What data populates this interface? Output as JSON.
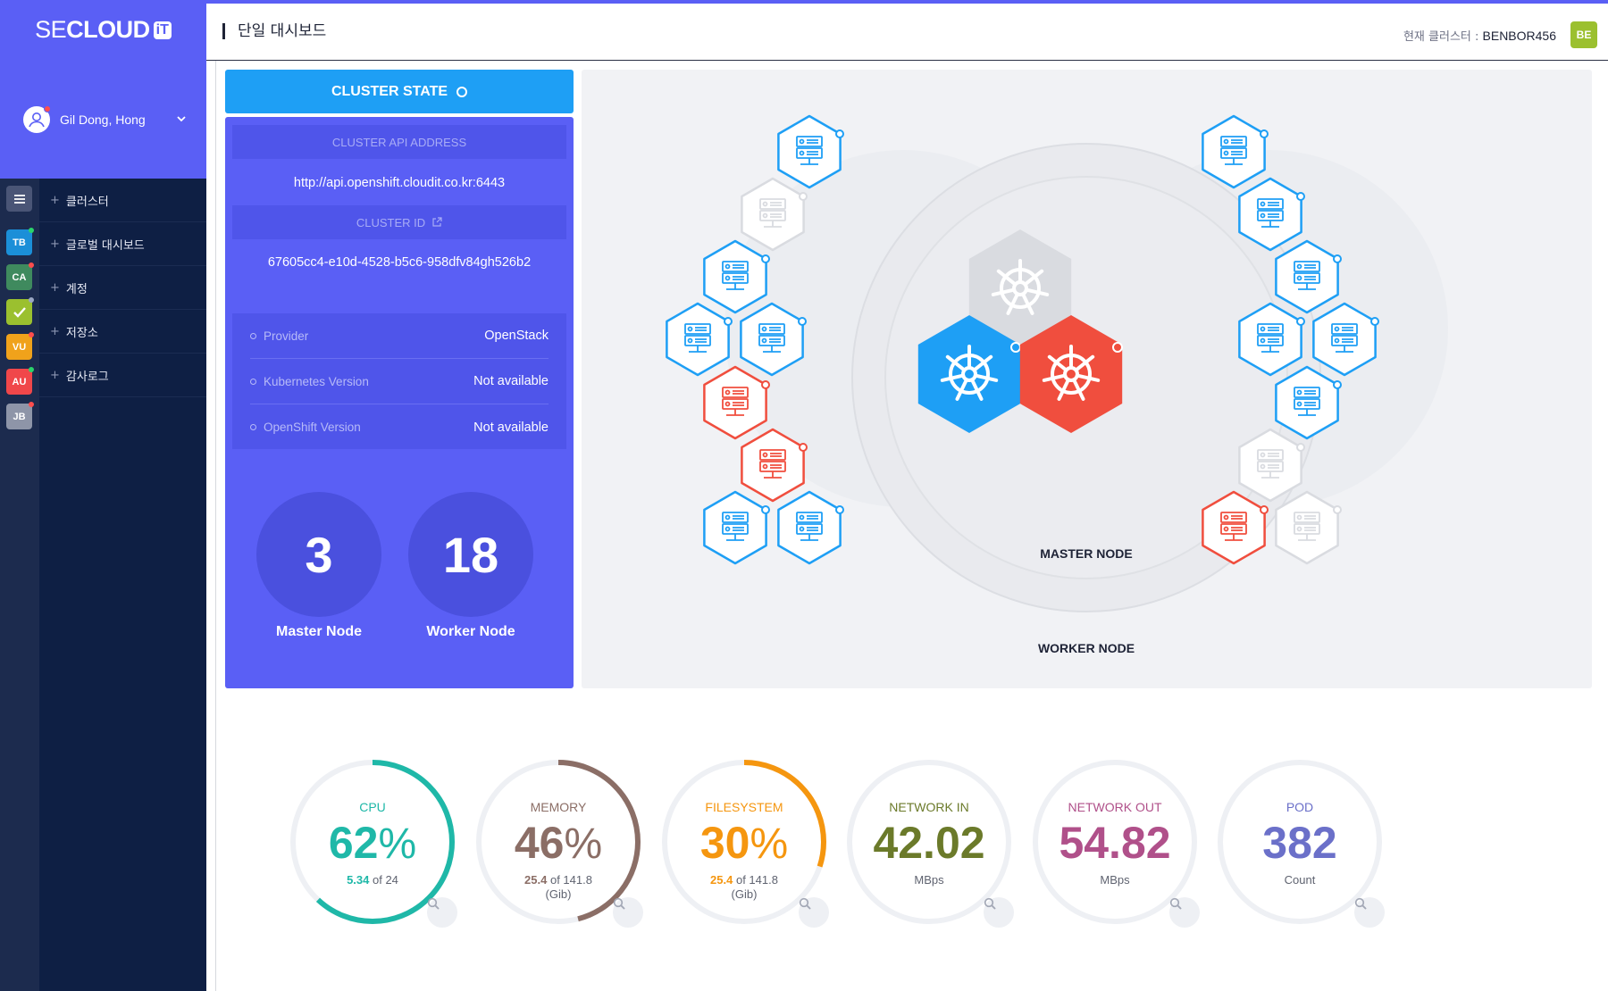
{
  "brand": {
    "name_light": "SE",
    "name_bold": "CLOUD",
    "badge": "iT"
  },
  "user": {
    "name": "Gil Dong, Hong"
  },
  "rail": [
    {
      "code": "",
      "icon": "menu-icon",
      "color": "#4a5576",
      "dot": ""
    },
    {
      "code": "TB",
      "color": "#1b8fd8",
      "dot": "#2bd46b"
    },
    {
      "code": "CA",
      "color": "#3f8a5e",
      "dot": "#ff4d4d"
    },
    {
      "code": "",
      "icon": "check-icon",
      "color": "#9bc02f",
      "dot": "#9ba7c4"
    },
    {
      "code": "VU",
      "color": "#f0a21b",
      "dot": "#ff4d4d"
    },
    {
      "code": "AU",
      "color": "#f0474a",
      "dot": "#2bd46b"
    },
    {
      "code": "JB",
      "color": "#8e95a8",
      "dot": "#ff4d4d"
    }
  ],
  "nav": [
    "클러스터",
    "글로벌 대시보드",
    "계정",
    "저장소",
    "감사로그"
  ],
  "header": {
    "title": "단일 대시보드",
    "cluster_label": "현재 클러스터 : ",
    "cluster_name": "BENBOR456",
    "cluster_badge": "BE"
  },
  "cluster_state": {
    "title": "CLUSTER STATE",
    "api_label": "CLUSTER API ADDRESS",
    "api_value": "http://api.openshift.cloudit.co.kr:6443",
    "id_label": "CLUSTER ID",
    "id_value": "67605cc4-e10d-4528-b5c6-958dfv84gh526b2",
    "properties": [
      {
        "label": "Provider",
        "value": "OpenStack"
      },
      {
        "label": "Kubernetes Version",
        "value": "Not available"
      },
      {
        "label": "OpenShift Version",
        "value": "Not available"
      }
    ],
    "master_count": "3",
    "master_label": "Master Node",
    "worker_count": "18",
    "worker_label": "Worker Node"
  },
  "topology": {
    "master_label": "MASTER NODE",
    "worker_label": "WORKER NODE",
    "colors": {
      "active": "#1e9ff5",
      "error": "#f04e3e",
      "idle": "#d9dbe0"
    },
    "master_nodes": [
      "idle",
      "active",
      "error"
    ],
    "worker_nodes_left": [
      "active",
      "idle",
      "active",
      "active",
      "active",
      "error",
      "error",
      "active",
      "active"
    ],
    "worker_nodes_right": [
      "active",
      "active",
      "active",
      "active",
      "active",
      "active",
      "idle",
      "error",
      "idle"
    ]
  },
  "metrics": [
    {
      "label": "CPU",
      "value": "62",
      "unit": "%",
      "fraction": 0.62,
      "used": "5.34",
      "of": "of 24",
      "sub2": "",
      "color": "#1fb8a8"
    },
    {
      "label": "MEMORY",
      "value": "46",
      "unit": "%",
      "fraction": 0.46,
      "used": "25.4",
      "of": "of 141.8",
      "sub2": "(Gib)",
      "color": "#8b6e66"
    },
    {
      "label": "FILESYSTEM",
      "value": "30",
      "unit": "%",
      "fraction": 0.3,
      "used": "25.4",
      "of": "of 141.8",
      "sub2": "(Gib)",
      "color": "#f5960f"
    },
    {
      "label": "NETWORK IN",
      "value": "42.02",
      "unit": "",
      "fraction": 0,
      "used": "",
      "of": "MBps",
      "sub2": "",
      "color": "#6b7a2a"
    },
    {
      "label": "NETWORK OUT",
      "value": "54.82",
      "unit": "",
      "fraction": 0,
      "used": "",
      "of": "MBps",
      "sub2": "",
      "color": "#b0508a"
    },
    {
      "label": "POD",
      "value": "382",
      "unit": "",
      "fraction": 0,
      "used": "",
      "of": "Count",
      "sub2": "",
      "color": "#6b70c9"
    }
  ]
}
